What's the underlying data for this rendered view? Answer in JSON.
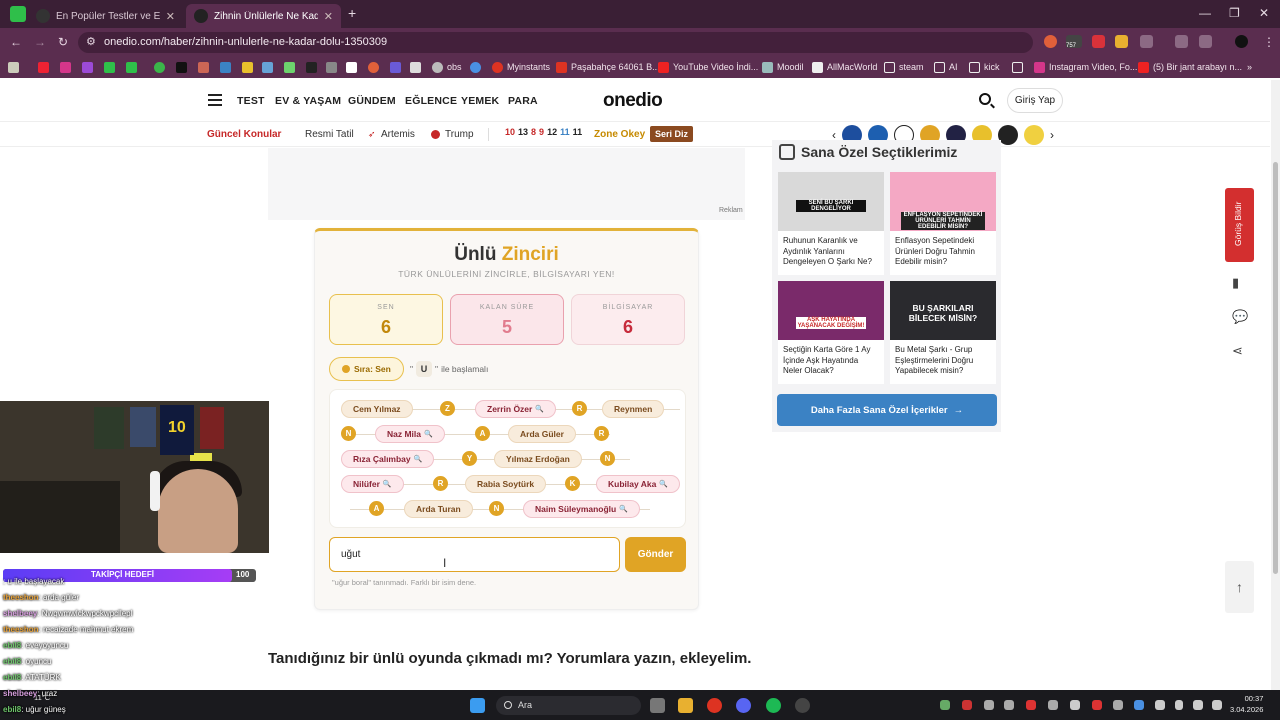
{
  "browser": {
    "tabs": [
      {
        "title": "En Popüler Testler ve Eğlenceli...",
        "active": false
      },
      {
        "title": "Zihnin Ünlülerle Ne Kadar Dolu...",
        "active": true
      }
    ],
    "url": "onedio.com/haber/zihnin-unlulerle-ne-kadar-dolu-1350309",
    "extension_badge": "757",
    "bookmarks": [
      "obs",
      "Myinstants",
      "Paşabahçe 64061 B...",
      "YouTube Video İndi...",
      "Moodil",
      "AllMacWorld",
      "steam",
      "AI",
      "kick",
      "Instagram Video, Fo...",
      "(5) Bir jant arabayı n..."
    ]
  },
  "site": {
    "nav": [
      "TEST",
      "EV & YAŞAM",
      "GÜNDEM",
      "EĞLENCE",
      "YEMEK",
      "PARA"
    ],
    "logo": "onedio",
    "login": "Giriş Yap",
    "subnav": {
      "current": "Güncel Konular",
      "topics": [
        "Resmi Tatil",
        "Artemis",
        "Trump"
      ],
      "numbers": [
        "10",
        "13",
        "8",
        "9",
        "12",
        "11",
        "11"
      ],
      "zone": "Zone Okey",
      "seri": "Seri Diz"
    },
    "ad_label": "Reklam"
  },
  "game": {
    "title_a": "Ünlü",
    "title_b": "Zinciri",
    "subtitle": "TÜRK ÜNLÜLERİNİ ZİNCİRLE, BİLGİSAYARI YEN!",
    "scores": {
      "you_label": "SEN",
      "you_value": "6",
      "time_label": "KALAN SÜRE",
      "time_value": "5",
      "pc_label": "BİLGİSAYAR",
      "pc_value": "6"
    },
    "turn": "Sıra: Sen",
    "hint_letter": "U",
    "hint_text": "ile başlamalı",
    "chain": [
      {
        "name": "Cem Yılmaz",
        "by": "you"
      },
      {
        "letter": "Z"
      },
      {
        "name": "Zerrin Özer",
        "by": "pc"
      },
      {
        "letter": "R"
      },
      {
        "name": "Reynmen",
        "by": "you"
      },
      {
        "letter": "N"
      },
      {
        "name": "Naz Mila",
        "by": "pc"
      },
      {
        "letter": "A"
      },
      {
        "name": "Arda Güler",
        "by": "you"
      },
      {
        "letter": "R"
      },
      {
        "name": "Rıza Çalımbay",
        "by": "pc"
      },
      {
        "letter": "Y"
      },
      {
        "name": "Yılmaz Erdoğan",
        "by": "you"
      },
      {
        "letter": "N"
      },
      {
        "name": "Nilüfer",
        "by": "pc"
      },
      {
        "letter": "R"
      },
      {
        "name": "Rabia Soytürk",
        "by": "you"
      },
      {
        "letter": "K"
      },
      {
        "name": "Kubilay Aka",
        "by": "pc"
      },
      {
        "letter": "A"
      },
      {
        "name": "Arda Turan",
        "by": "you"
      },
      {
        "letter": "N"
      },
      {
        "name": "Naim Süleymanoğlu",
        "by": "pc"
      }
    ],
    "input_value": "uğut",
    "send_label": "Gönder",
    "error": "\"uğur boral\" tanınmadı. Farklı bir isim dene."
  },
  "comment_cta": "Tanıdığınız bir ünlü oyunda çıkmadı mı? Yorumlara yazın, ekleyelim.",
  "recommendations": {
    "title": "Sana Özel Seçtiklerimiz",
    "items": [
      {
        "title": "Ruhunun Karanlık ve Aydınlık Yanlarını Dengeleyen O Şarkı Ne?",
        "overlay": "SENİ BU ŞARKI DENGELİYOR",
        "color": "#d9d9d9"
      },
      {
        "title": "Enflasyon Sepetindeki Ürünleri Doğru Tahmin Edebilir misin?",
        "overlay": "ENFLASYON SEPETİNDEKİ ÜRÜNLERİ TAHMİN EDEBİLİR MİSİN?",
        "color": "#f4a8c4"
      },
      {
        "title": "Seçtiğin Karta Göre 1 Ay İçinde Aşk Hayatında Neler Olacak?",
        "overlay": "AŞK HAYATINDA YAŞANACAK DEĞİŞİM!",
        "color": "#7a2a6a"
      },
      {
        "title": "Bu Metal Şarkı - Grup Eşleştirmelerini Doğru Yapabilecek misin?",
        "overlay": "BU ŞARKILARI BİLECEK MİSİN?",
        "color": "#2a2a2e"
      }
    ],
    "more": "Daha Fazla Sana Özel İçerikler"
  },
  "sidebar": {
    "feedback": "Görüş Bildir"
  },
  "stream": {
    "jersey_number": "10",
    "follower_label": "TAKİPÇİ HEDEFİ",
    "follower_count": "100",
    "chat": [
      {
        "user": "",
        "text": ": u ile başlayacak"
      },
      {
        "user": "theeshon",
        "text": ": arda güler"
      },
      {
        "user": "shelbeey",
        "text": ": Nwqwmwlckwpckwpcllepl"
      },
      {
        "user": "theeshon",
        "text": ": recaizade mahmut ekrem"
      },
      {
        "user": "ebil8",
        "text": ": eveyoyuncu"
      },
      {
        "user": "ebil8",
        "text": ": oyuncu"
      },
      {
        "user": "ebil8",
        "text": ": ATATÜRK"
      },
      {
        "user": "shelbeey",
        "text": ": uraz"
      },
      {
        "user": "ebil8",
        "text": ": uğur güneş"
      }
    ]
  },
  "taskbar": {
    "search": "Ara",
    "time": "00:37",
    "date": "3.04.2026",
    "temp": "11°C"
  }
}
